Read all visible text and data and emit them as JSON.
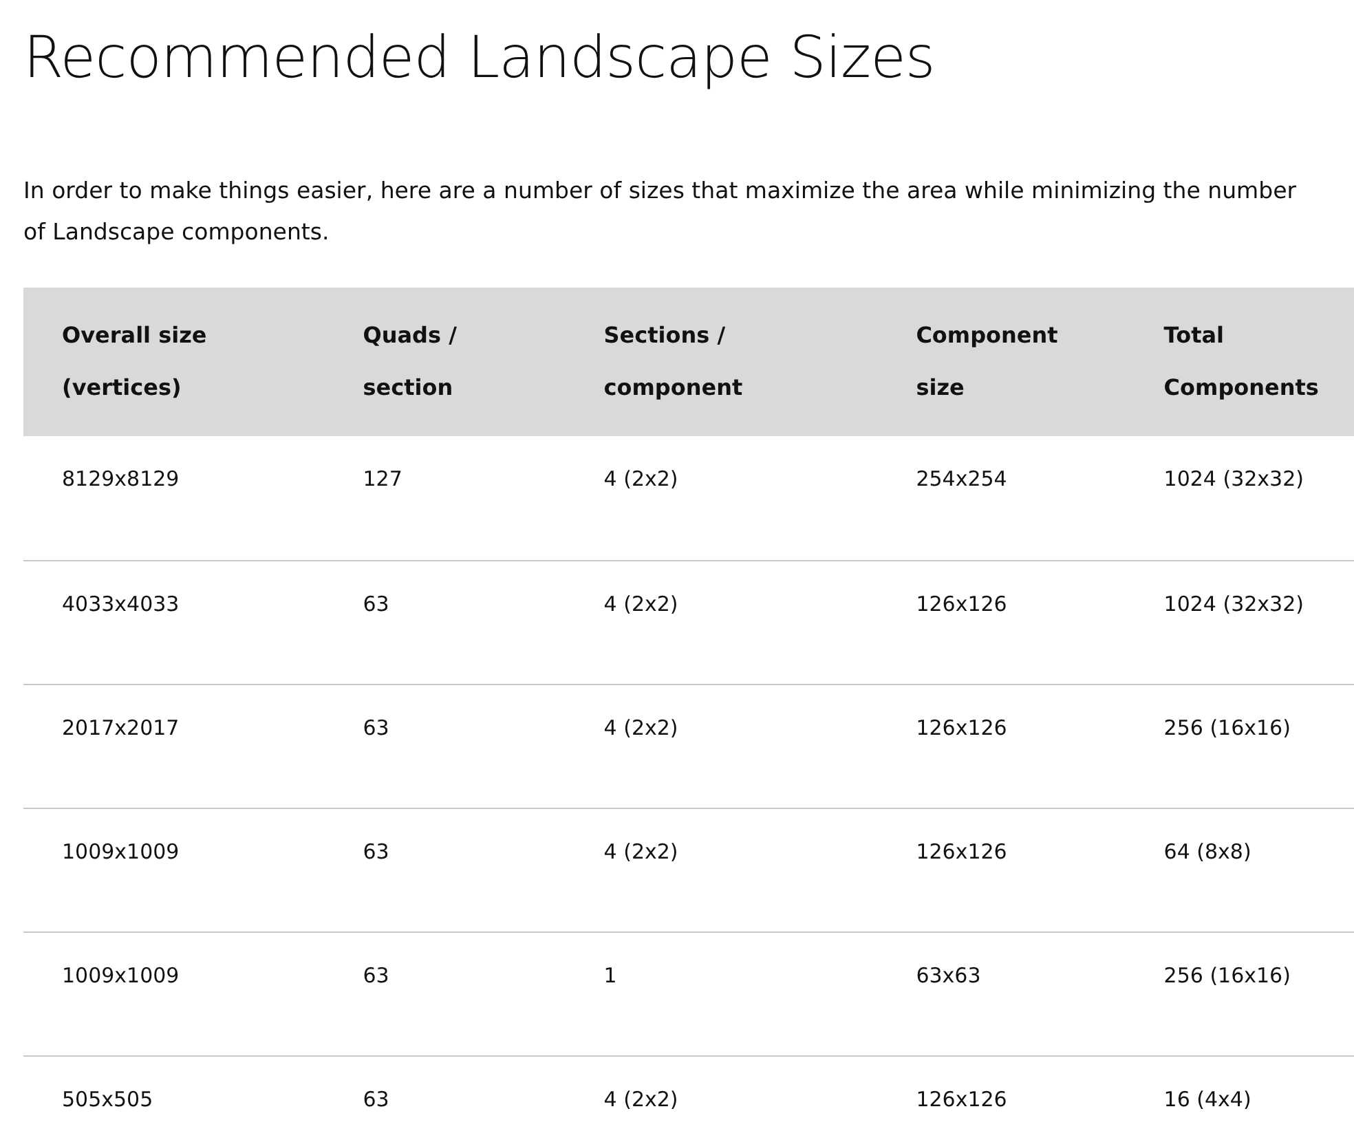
{
  "title": "Recommended Landscape Sizes",
  "intro": "In order to make things easier, here are a number of sizes that maximize the area while minimizing the number of Landscape components.",
  "table": {
    "columns": [
      "Overall size (vertices)",
      "Quads / section",
      "Sections / component",
      "Component size",
      "Total Components"
    ],
    "rows": [
      [
        "8129x8129",
        "127",
        "4 (2x2)",
        "254x254",
        "1024 (32x32)"
      ],
      [
        "4033x4033",
        "63",
        "4 (2x2)",
        "126x126",
        "1024 (32x32)"
      ],
      [
        "2017x2017",
        "63",
        "4 (2x2)",
        "126x126",
        "256 (16x16)"
      ],
      [
        "1009x1009",
        "63",
        "4 (2x2)",
        "126x126",
        "64 (8x8)"
      ],
      [
        "1009x1009",
        "63",
        "1",
        "63x63",
        "256 (16x16)"
      ],
      [
        "505x505",
        "63",
        "4 (2x2)",
        "126x126",
        "16 (4x4)"
      ]
    ]
  }
}
